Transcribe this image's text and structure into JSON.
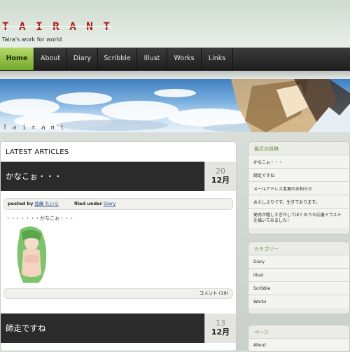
{
  "header": {
    "logo_text": "TAIRANT",
    "tagline": "Taira's work for world"
  },
  "nav": {
    "items": [
      {
        "label": "Home",
        "active": true
      },
      {
        "label": "About"
      },
      {
        "label": "Diary"
      },
      {
        "label": "Scribble"
      },
      {
        "label": "Illust"
      },
      {
        "label": "Works"
      },
      {
        "label": "Links"
      }
    ]
  },
  "banner": {
    "logo_text": "Tairant"
  },
  "main": {
    "section_title": "LATEST ARTICLES",
    "posts": [
      {
        "title": "かなこぉ・・・",
        "day": "20",
        "month": "12月",
        "posted_by_label": "posted by",
        "author": "加藤 たいら",
        "filed_under_label": "filed under",
        "category": "Diary",
        "excerpt": "・・・・・・・かなこぉ・・・",
        "comments": "コメント (19)"
      },
      {
        "title": "師走ですね",
        "day": "13",
        "month": "12月"
      }
    ]
  },
  "sidebar": {
    "recent": {
      "title": "最近の投稿",
      "items": [
        "かなこぉ・・・",
        "師走ですね",
        "メールアドレス変更のお知らせ",
        "おえしぶりです。生きております。",
        "発売が嬉しすぎかしてぼくのうた応援イラストを描いてみました！"
      ]
    },
    "categories": {
      "title": "カテゴリー",
      "items": [
        "Diary",
        "Illust",
        "Scribble",
        "Works"
      ]
    },
    "pages": {
      "title": "ページ",
      "items": [
        "About"
      ]
    }
  },
  "colors": {
    "nav_active": "#8dbd3f",
    "nav_bg": "#2a2a2a",
    "post_head_bg": "#2b2b2b",
    "widget_title": "#6d8a37",
    "logo_red": "#b01818"
  }
}
